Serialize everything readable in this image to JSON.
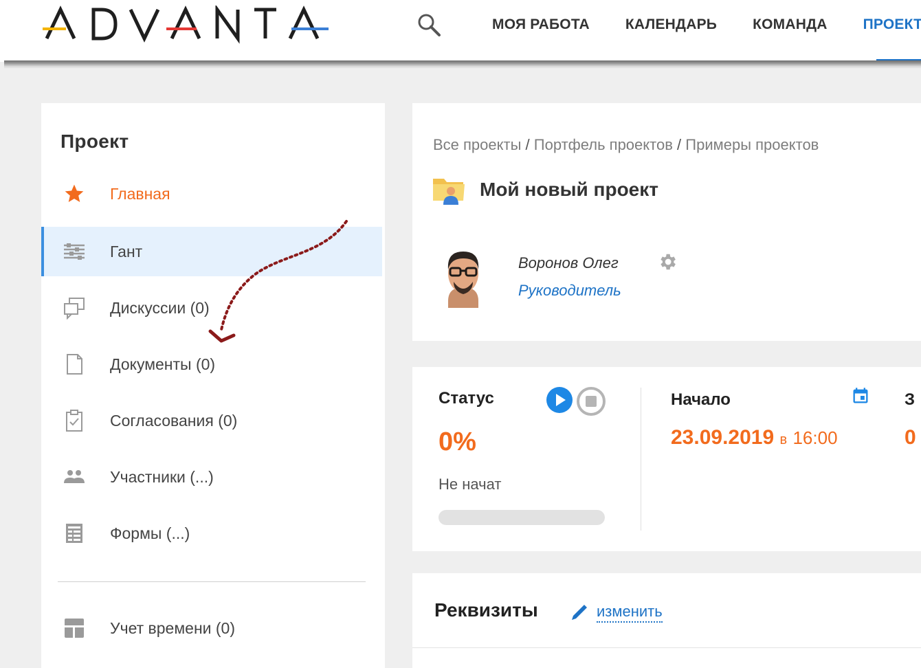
{
  "header": {
    "logo_text": "ADVANTA",
    "nav": [
      {
        "label": "МОЯ РАБОТА",
        "active": false
      },
      {
        "label": "КАЛЕНДАРЬ",
        "active": false
      },
      {
        "label": "КОМАНДА",
        "active": false
      },
      {
        "label": "ПРОЕКТЫ",
        "active": true
      }
    ]
  },
  "sidebar": {
    "title": "Проект",
    "items": [
      {
        "label": "Главная",
        "icon": "star-icon"
      },
      {
        "label": "Гант",
        "icon": "gantt-icon"
      },
      {
        "label": "Дискуссии (0)",
        "icon": "discussions-icon"
      },
      {
        "label": "Документы (0)",
        "icon": "document-icon"
      },
      {
        "label": "Согласования (0)",
        "icon": "approval-icon"
      },
      {
        "label": "Участники (...)",
        "icon": "participants-icon"
      },
      {
        "label": "Формы (...)",
        "icon": "forms-icon"
      },
      {
        "label": "Учет времени (0)",
        "icon": "time-tracking-icon"
      }
    ]
  },
  "project": {
    "breadcrumb": [
      "Все проекты",
      "Портфель проектов",
      "Примеры проектов"
    ],
    "title": "Мой новый проект",
    "manager": {
      "name": "Воронов Олег",
      "role": "Руководитель"
    }
  },
  "status_card": {
    "status_label": "Статус",
    "progress_percent": "0%",
    "progress_value": 0,
    "status_text": "Не начат",
    "start_label": "Начало",
    "start_date": "23.09.2019",
    "start_time_prefix": "в",
    "start_time": "16:00",
    "next_label": "З",
    "next_value": "0"
  },
  "requisites": {
    "title": "Реквизиты",
    "edit_label": "изменить"
  },
  "colors": {
    "accent_orange": "#f26b1d",
    "link_blue": "#1e73c6",
    "active_bg": "#e5f1fd",
    "arrow": "#8b1a1a"
  }
}
